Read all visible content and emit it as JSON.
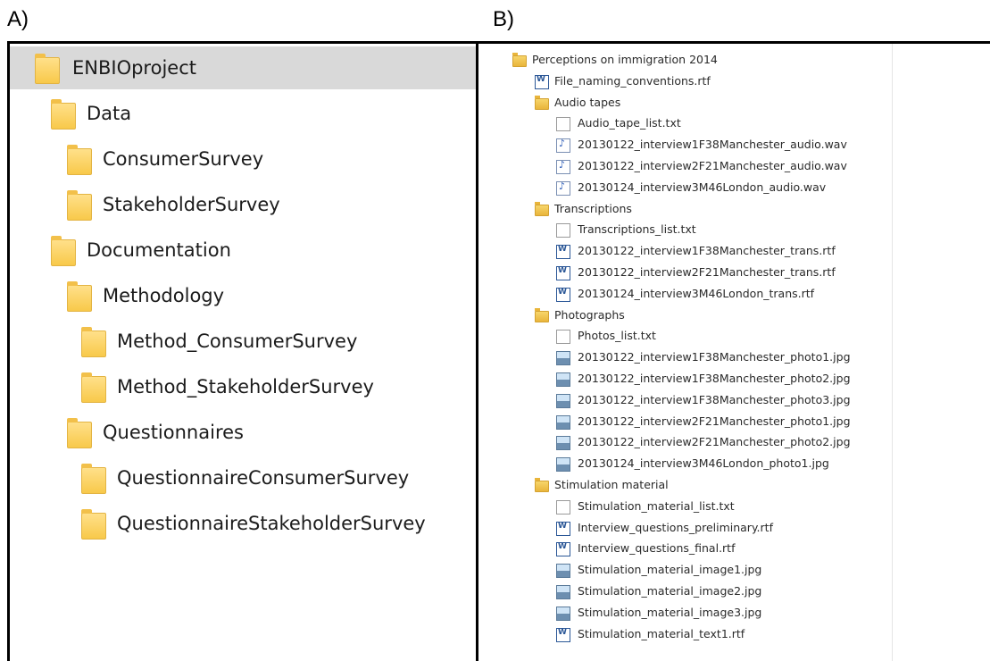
{
  "labels": {
    "a": "A)",
    "b": "B)"
  },
  "panel_a": {
    "items": [
      {
        "label": "ENBIOproject",
        "depth": 0,
        "selected": true
      },
      {
        "label": "Data",
        "depth": 1
      },
      {
        "label": "ConsumerSurvey",
        "depth": 2
      },
      {
        "label": "StakeholderSurvey",
        "depth": 2
      },
      {
        "label": "Documentation",
        "depth": 1
      },
      {
        "label": "Methodology",
        "depth": 2
      },
      {
        "label": "Method_ConsumerSurvey",
        "depth": 3
      },
      {
        "label": "Method_StakeholderSurvey",
        "depth": 3
      },
      {
        "label": "Questionnaires",
        "depth": 2
      },
      {
        "label": "QuestionnaireConsumerSurvey",
        "depth": 3
      },
      {
        "label": "QuestionnaireStakeholderSurvey",
        "depth": 3
      }
    ]
  },
  "panel_b": {
    "items": [
      {
        "label": "Perceptions on immigration 2014",
        "type": "folder",
        "depth": 0
      },
      {
        "label": "File_naming_conventions.rtf",
        "type": "rtf",
        "depth": 1
      },
      {
        "label": "Audio tapes",
        "type": "folder",
        "depth": 1
      },
      {
        "label": "Audio_tape_list.txt",
        "type": "txt",
        "depth": 2
      },
      {
        "label": "20130122_interview1F38Manchester_audio.wav",
        "type": "wav",
        "depth": 2
      },
      {
        "label": "20130122_interview2F21Manchester_audio.wav",
        "type": "wav",
        "depth": 2
      },
      {
        "label": "20130124_interview3M46London_audio.wav",
        "type": "wav",
        "depth": 2
      },
      {
        "label": "Transcriptions",
        "type": "folder",
        "depth": 1
      },
      {
        "label": "Transcriptions_list.txt",
        "type": "txt",
        "depth": 2
      },
      {
        "label": "20130122_interview1F38Manchester_trans.rtf",
        "type": "rtf",
        "depth": 2
      },
      {
        "label": "20130122_interview2F21Manchester_trans.rtf",
        "type": "rtf",
        "depth": 2
      },
      {
        "label": "20130124_interview3M46London_trans.rtf",
        "type": "rtf",
        "depth": 2
      },
      {
        "label": "Photographs",
        "type": "folder",
        "depth": 1
      },
      {
        "label": "Photos_list.txt",
        "type": "txt",
        "depth": 2
      },
      {
        "label": "20130122_interview1F38Manchester_photo1.jpg",
        "type": "jpg",
        "depth": 2
      },
      {
        "label": "20130122_interview1F38Manchester_photo2.jpg",
        "type": "jpg",
        "depth": 2
      },
      {
        "label": "20130122_interview1F38Manchester_photo3.jpg",
        "type": "jpg",
        "depth": 2
      },
      {
        "label": "20130122_interview2F21Manchester_photo1.jpg",
        "type": "jpg",
        "depth": 2
      },
      {
        "label": "20130122_interview2F21Manchester_photo2.jpg",
        "type": "jpg",
        "depth": 2
      },
      {
        "label": "20130124_interview3M46London_photo1.jpg",
        "type": "jpg",
        "depth": 2
      },
      {
        "label": "Stimulation material",
        "type": "folder",
        "depth": 1
      },
      {
        "label": "Stimulation_material_list.txt",
        "type": "txt",
        "depth": 2
      },
      {
        "label": "Interview_questions_preliminary.rtf",
        "type": "rtf",
        "depth": 2
      },
      {
        "label": "Interview_questions_final.rtf",
        "type": "rtf",
        "depth": 2
      },
      {
        "label": "Stimulation_material_image1.jpg",
        "type": "jpg",
        "depth": 2
      },
      {
        "label": "Stimulation_material_image2.jpg",
        "type": "jpg",
        "depth": 2
      },
      {
        "label": "Stimulation_material_image3.jpg",
        "type": "jpg",
        "depth": 2
      },
      {
        "label": "Stimulation_material_text1.rtf",
        "type": "rtf",
        "depth": 2
      }
    ]
  },
  "icons": {
    "folder": "folder-icon",
    "txt": "text-file-icon",
    "rtf": "rtf-document-icon",
    "wav": "audio-file-icon",
    "jpg": "image-file-icon"
  }
}
